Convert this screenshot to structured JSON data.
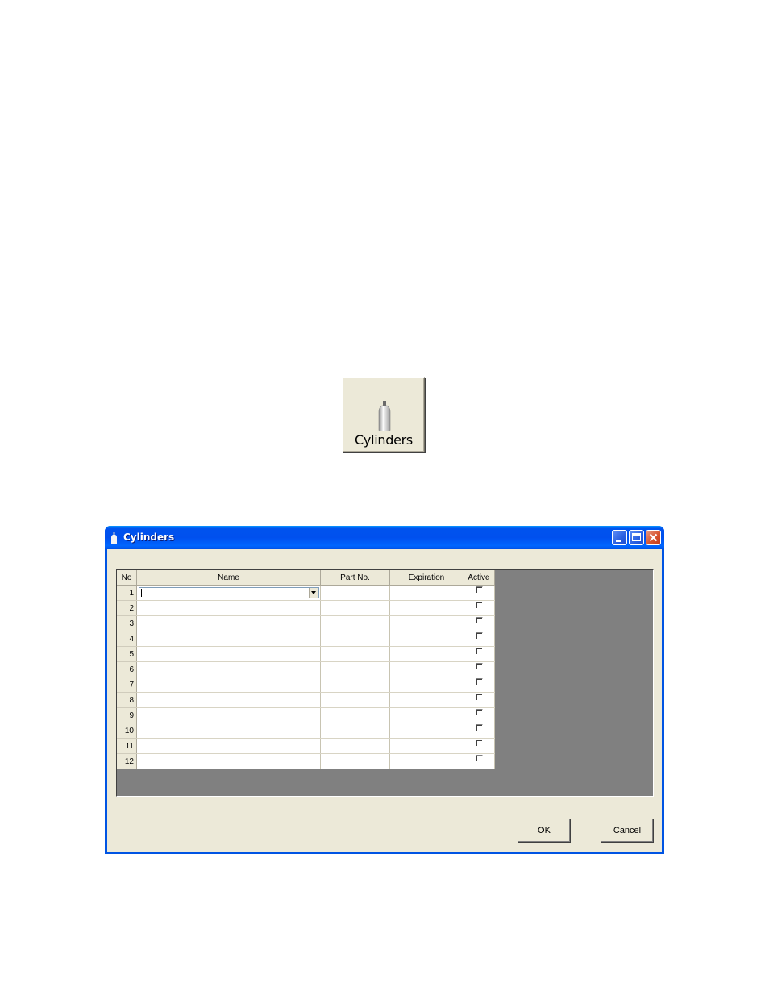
{
  "toolbar_button": {
    "label": "Cylinders",
    "icon": "cylinder-icon"
  },
  "window": {
    "title": "Cylinders",
    "icon": "cylinder-icon",
    "controls": [
      "minimize-icon",
      "maximize-icon",
      "close-icon"
    ]
  },
  "grid": {
    "headers": {
      "no": "No",
      "name": "Name",
      "part": "Part No.",
      "expiration": "Expiration",
      "active": "Active"
    },
    "rows": [
      {
        "no": "1",
        "name": "",
        "part": "",
        "expiration": "",
        "active": false
      },
      {
        "no": "2",
        "name": "",
        "part": "",
        "expiration": "",
        "active": false
      },
      {
        "no": "3",
        "name": "",
        "part": "",
        "expiration": "",
        "active": false
      },
      {
        "no": "4",
        "name": "",
        "part": "",
        "expiration": "",
        "active": false
      },
      {
        "no": "5",
        "name": "",
        "part": "",
        "expiration": "",
        "active": false
      },
      {
        "no": "6",
        "name": "",
        "part": "",
        "expiration": "",
        "active": false
      },
      {
        "no": "7",
        "name": "",
        "part": "",
        "expiration": "",
        "active": false
      },
      {
        "no": "8",
        "name": "",
        "part": "",
        "expiration": "",
        "active": false
      },
      {
        "no": "9",
        "name": "",
        "part": "",
        "expiration": "",
        "active": false
      },
      {
        "no": "10",
        "name": "",
        "part": "",
        "expiration": "",
        "active": false
      },
      {
        "no": "11",
        "name": "",
        "part": "",
        "expiration": "",
        "active": false
      },
      {
        "no": "12",
        "name": "",
        "part": "",
        "expiration": "",
        "active": false
      }
    ]
  },
  "buttons": {
    "ok": "OK",
    "cancel": "Cancel"
  },
  "colors": {
    "titlebar": "#0054e3",
    "face": "#ece9d8",
    "grid_background": "#808080"
  }
}
